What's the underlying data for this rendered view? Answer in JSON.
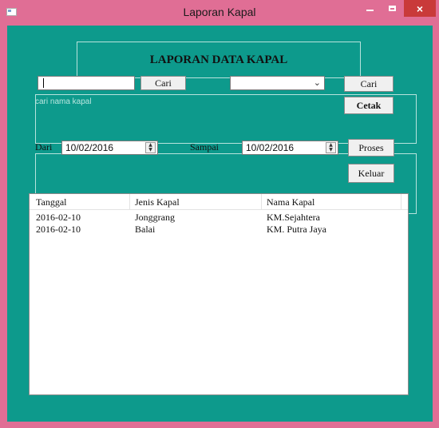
{
  "window": {
    "title": "Laporan Kapal",
    "controls": {
      "minimize": "minimize",
      "maximize": "maximize",
      "close": "×"
    },
    "colors": {
      "titlebar": "#e06e95",
      "client": "#0d9a8c",
      "close": "#c93a3a"
    }
  },
  "header": {
    "title": "LAPORAN DATA KAPAL"
  },
  "search": {
    "name_input_value": "",
    "cari_label": "Cari",
    "hint": "cari nama kapal",
    "combo_value": "",
    "cari2_label": "Cari",
    "cetak_label": "Cetak"
  },
  "filter": {
    "dari_label": "Dari",
    "dari_value": "10/02/2016",
    "sampai_label": "Sampai",
    "sampai_value": "10/02/2016",
    "proses_label": "Proses",
    "keluar_label": "Keluar"
  },
  "table": {
    "columns": [
      "Tanggal",
      "Jenis Kapal",
      "Nama Kapal"
    ],
    "rows": [
      [
        "2016-02-10",
        "Jonggrang",
        "KM.Sejahtera"
      ],
      [
        "2016-02-10",
        "Balai",
        "KM. Putra Jaya"
      ]
    ]
  }
}
